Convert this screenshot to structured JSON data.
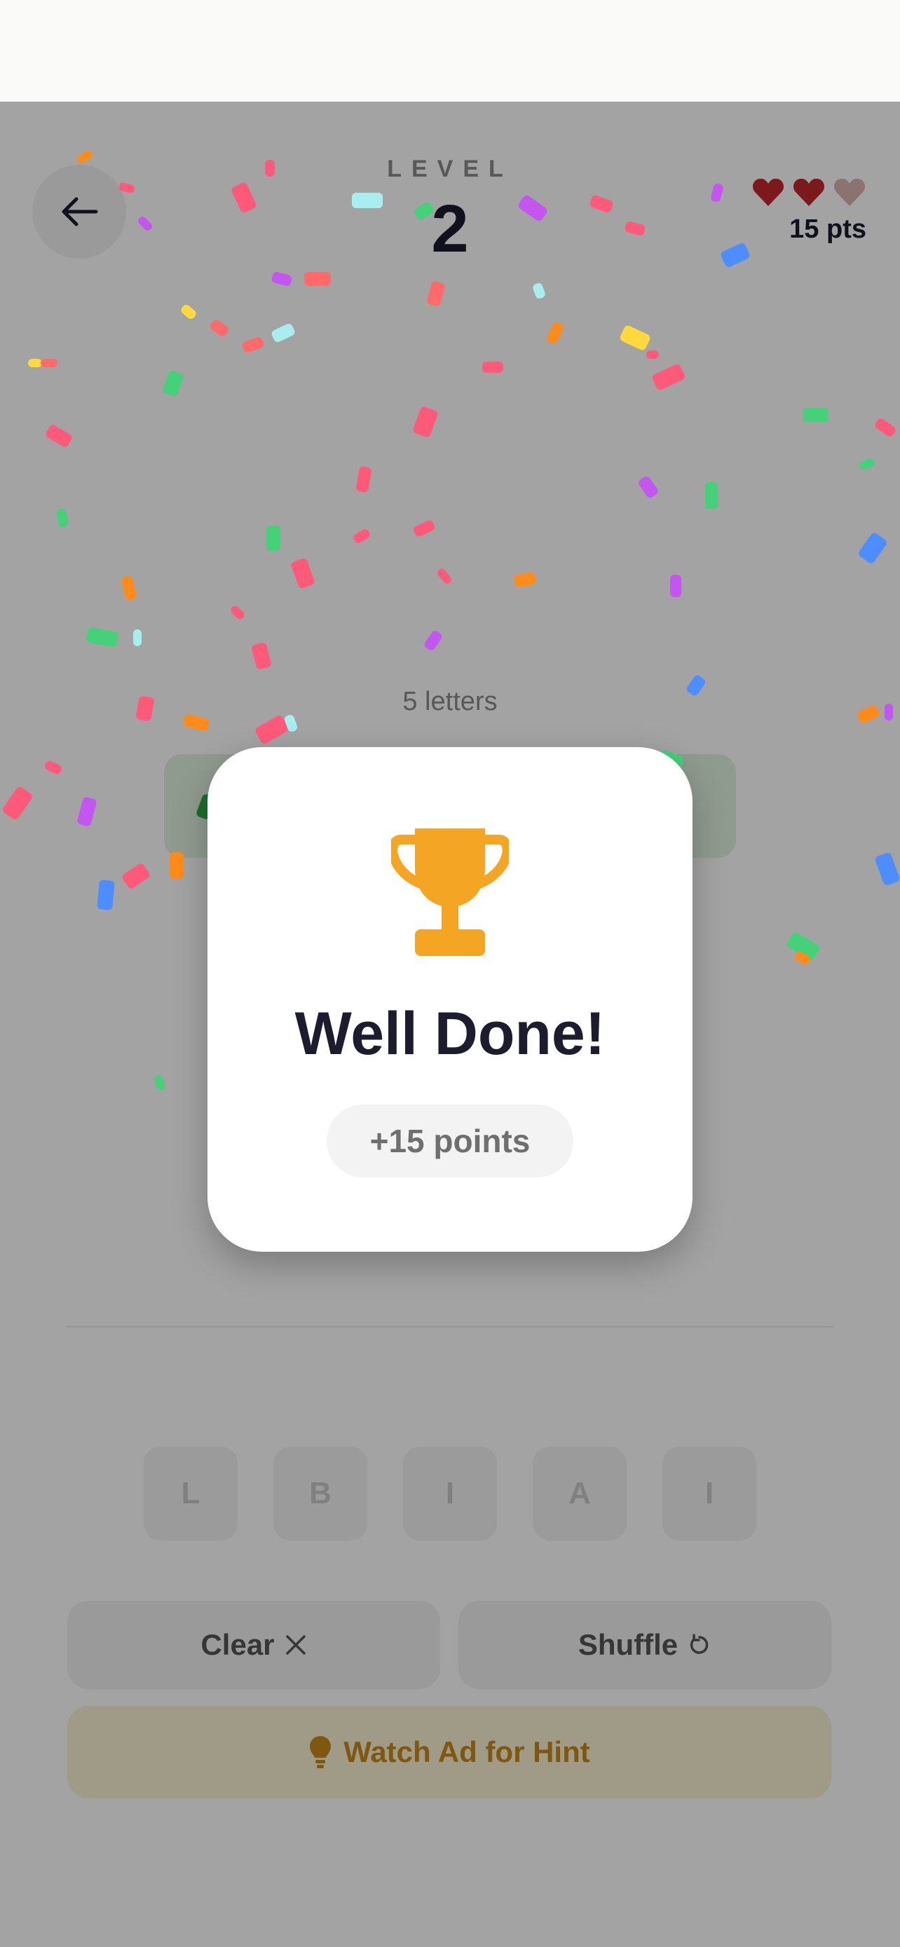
{
  "header": {
    "back_icon": "arrow-left-icon",
    "level_label": "LEVEL",
    "level_number": "2",
    "hearts": {
      "filled": 2,
      "total": 3,
      "filled_color": "#c0282d",
      "empty_color": "#d8b4b0"
    },
    "points": "15 pts"
  },
  "puzzle": {
    "letters_count": "5 letters",
    "letter_tiles": [
      "L",
      "B",
      "I",
      "A",
      "I"
    ]
  },
  "actions": {
    "clear_label": "Clear",
    "clear_icon": "x-icon",
    "shuffle_label": "Shuffle",
    "shuffle_icon": "rotate-icon",
    "hint_label": "Watch Ad for Hint",
    "hint_icon": "lightbulb-icon"
  },
  "modal": {
    "icon": "trophy-icon",
    "title": "Well Done!",
    "points": "+15 points",
    "trophy_color": "#f5a524"
  },
  "colors": {
    "accent_dark": "#1c1c2e",
    "confetti": [
      "#ff5a7a",
      "#c455f0",
      "#ff8c1a",
      "#44d17a",
      "#4d8dff",
      "#a8eeee",
      "#ffd93d",
      "#ff6a6a"
    ]
  }
}
